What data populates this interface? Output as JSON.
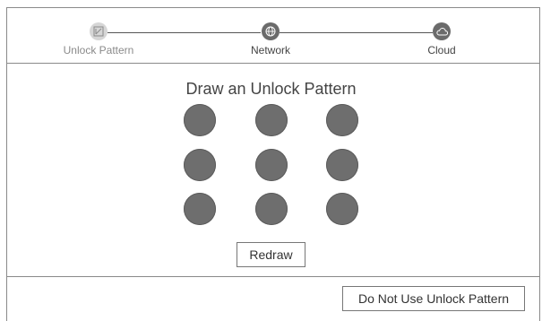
{
  "steps": [
    {
      "label": "Unlock Pattern",
      "icon": "pattern-icon",
      "state": "inactive"
    },
    {
      "label": "Network",
      "icon": "globe-icon",
      "state": "active"
    },
    {
      "label": "Cloud",
      "icon": "cloud-icon",
      "state": "active"
    }
  ],
  "main": {
    "title": "Draw an Unlock Pattern",
    "pattern_dot_count": 9,
    "redraw_label": "Redraw"
  },
  "footer": {
    "skip_label": "Do Not Use Unlock Pattern"
  },
  "colors": {
    "dot": "#6e6e6e",
    "active_step": "#6b6b6b",
    "inactive_step": "#d6d6d6",
    "border": "#8a8a8a"
  }
}
